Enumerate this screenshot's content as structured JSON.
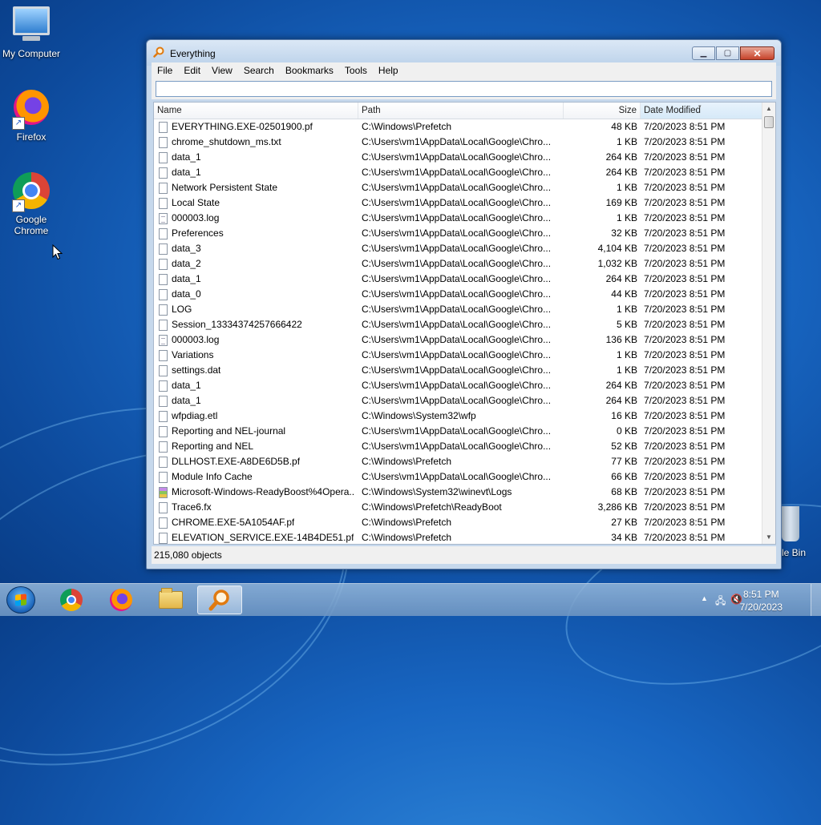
{
  "desktop": {
    "icons": [
      {
        "label": "My Computer",
        "icon": "computer-icon"
      },
      {
        "label": "Firefox",
        "icon": "firefox-icon"
      },
      {
        "label": "Google Chrome",
        "icon": "chrome-icon"
      }
    ],
    "recycle_bin_label": "le Bin"
  },
  "window": {
    "title": "Everything",
    "menu": [
      "File",
      "Edit",
      "View",
      "Search",
      "Bookmarks",
      "Tools",
      "Help"
    ],
    "search": {
      "value": "",
      "placeholder": ""
    },
    "columns": {
      "name": "Name",
      "path": "Path",
      "size": "Size",
      "date": "Date Modified"
    },
    "rows": [
      {
        "name": "EVERYTHING.EXE-02501900.pf",
        "path": "C:\\Windows\\Prefetch",
        "size": "48 KB",
        "date": "7/20/2023 8:51 PM",
        "icon": "file"
      },
      {
        "name": "chrome_shutdown_ms.txt",
        "path": "C:\\Users\\vm1\\AppData\\Local\\Google\\Chro...",
        "size": "1 KB",
        "date": "7/20/2023 8:51 PM",
        "icon": "file"
      },
      {
        "name": "data_1",
        "path": "C:\\Users\\vm1\\AppData\\Local\\Google\\Chro...",
        "size": "264 KB",
        "date": "7/20/2023 8:51 PM",
        "icon": "file"
      },
      {
        "name": "data_1",
        "path": "C:\\Users\\vm1\\AppData\\Local\\Google\\Chro...",
        "size": "264 KB",
        "date": "7/20/2023 8:51 PM",
        "icon": "file"
      },
      {
        "name": "Network Persistent State",
        "path": "C:\\Users\\vm1\\AppData\\Local\\Google\\Chro...",
        "size": "1 KB",
        "date": "7/20/2023 8:51 PM",
        "icon": "file"
      },
      {
        "name": "Local State",
        "path": "C:\\Users\\vm1\\AppData\\Local\\Google\\Chro...",
        "size": "169 KB",
        "date": "7/20/2023 8:51 PM",
        "icon": "file"
      },
      {
        "name": "000003.log",
        "path": "C:\\Users\\vm1\\AppData\\Local\\Google\\Chro...",
        "size": "1 KB",
        "date": "7/20/2023 8:51 PM",
        "icon": "text"
      },
      {
        "name": "Preferences",
        "path": "C:\\Users\\vm1\\AppData\\Local\\Google\\Chro...",
        "size": "32 KB",
        "date": "7/20/2023 8:51 PM",
        "icon": "file"
      },
      {
        "name": "data_3",
        "path": "C:\\Users\\vm1\\AppData\\Local\\Google\\Chro...",
        "size": "4,104 KB",
        "date": "7/20/2023 8:51 PM",
        "icon": "file"
      },
      {
        "name": "data_2",
        "path": "C:\\Users\\vm1\\AppData\\Local\\Google\\Chro...",
        "size": "1,032 KB",
        "date": "7/20/2023 8:51 PM",
        "icon": "file"
      },
      {
        "name": "data_1",
        "path": "C:\\Users\\vm1\\AppData\\Local\\Google\\Chro...",
        "size": "264 KB",
        "date": "7/20/2023 8:51 PM",
        "icon": "file"
      },
      {
        "name": "data_0",
        "path": "C:\\Users\\vm1\\AppData\\Local\\Google\\Chro...",
        "size": "44 KB",
        "date": "7/20/2023 8:51 PM",
        "icon": "file"
      },
      {
        "name": "LOG",
        "path": "C:\\Users\\vm1\\AppData\\Local\\Google\\Chro...",
        "size": "1 KB",
        "date": "7/20/2023 8:51 PM",
        "icon": "file"
      },
      {
        "name": "Session_13334374257666422",
        "path": "C:\\Users\\vm1\\AppData\\Local\\Google\\Chro...",
        "size": "5 KB",
        "date": "7/20/2023 8:51 PM",
        "icon": "file"
      },
      {
        "name": "000003.log",
        "path": "C:\\Users\\vm1\\AppData\\Local\\Google\\Chro...",
        "size": "136 KB",
        "date": "7/20/2023 8:51 PM",
        "icon": "text"
      },
      {
        "name": "Variations",
        "path": "C:\\Users\\vm1\\AppData\\Local\\Google\\Chro...",
        "size": "1 KB",
        "date": "7/20/2023 8:51 PM",
        "icon": "file"
      },
      {
        "name": "settings.dat",
        "path": "C:\\Users\\vm1\\AppData\\Local\\Google\\Chro...",
        "size": "1 KB",
        "date": "7/20/2023 8:51 PM",
        "icon": "file"
      },
      {
        "name": "data_1",
        "path": "C:\\Users\\vm1\\AppData\\Local\\Google\\Chro...",
        "size": "264 KB",
        "date": "7/20/2023 8:51 PM",
        "icon": "file"
      },
      {
        "name": "data_1",
        "path": "C:\\Users\\vm1\\AppData\\Local\\Google\\Chro...",
        "size": "264 KB",
        "date": "7/20/2023 8:51 PM",
        "icon": "file"
      },
      {
        "name": "wfpdiag.etl",
        "path": "C:\\Windows\\System32\\wfp",
        "size": "16 KB",
        "date": "7/20/2023 8:51 PM",
        "icon": "file"
      },
      {
        "name": "Reporting and NEL-journal",
        "path": "C:\\Users\\vm1\\AppData\\Local\\Google\\Chro...",
        "size": "0 KB",
        "date": "7/20/2023 8:51 PM",
        "icon": "file"
      },
      {
        "name": "Reporting and NEL",
        "path": "C:\\Users\\vm1\\AppData\\Local\\Google\\Chro...",
        "size": "52 KB",
        "date": "7/20/2023 8:51 PM",
        "icon": "file"
      },
      {
        "name": "DLLHOST.EXE-A8DE6D5B.pf",
        "path": "C:\\Windows\\Prefetch",
        "size": "77 KB",
        "date": "7/20/2023 8:51 PM",
        "icon": "file"
      },
      {
        "name": "Module Info Cache",
        "path": "C:\\Users\\vm1\\AppData\\Local\\Google\\Chro...",
        "size": "66 KB",
        "date": "7/20/2023 8:51 PM",
        "icon": "file"
      },
      {
        "name": "Microsoft-Windows-ReadyBoost%4Opera...",
        "path": "C:\\Windows\\System32\\winevt\\Logs",
        "size": "68 KB",
        "date": "7/20/2023 8:51 PM",
        "icon": "event"
      },
      {
        "name": "Trace6.fx",
        "path": "C:\\Windows\\Prefetch\\ReadyBoot",
        "size": "3,286 KB",
        "date": "7/20/2023 8:51 PM",
        "icon": "file"
      },
      {
        "name": "CHROME.EXE-5A1054AF.pf",
        "path": "C:\\Windows\\Prefetch",
        "size": "27 KB",
        "date": "7/20/2023 8:51 PM",
        "icon": "file"
      },
      {
        "name": "ELEVATION_SERVICE.EXE-14B4DE51.pf",
        "path": "C:\\Windows\\Prefetch",
        "size": "34 KB",
        "date": "7/20/2023 8:51 PM",
        "icon": "file"
      }
    ],
    "status": "215,080 objects"
  },
  "taskbar": {
    "pinned": [
      {
        "name": "chrome",
        "icon": "chrome-icon"
      },
      {
        "name": "firefox",
        "icon": "firefox-icon"
      },
      {
        "name": "explorer",
        "icon": "folder-icon"
      },
      {
        "name": "everything",
        "icon": "magnifier-icon",
        "active": true
      }
    ],
    "clock_time": "8:51 PM",
    "clock_date": "7/20/2023"
  }
}
